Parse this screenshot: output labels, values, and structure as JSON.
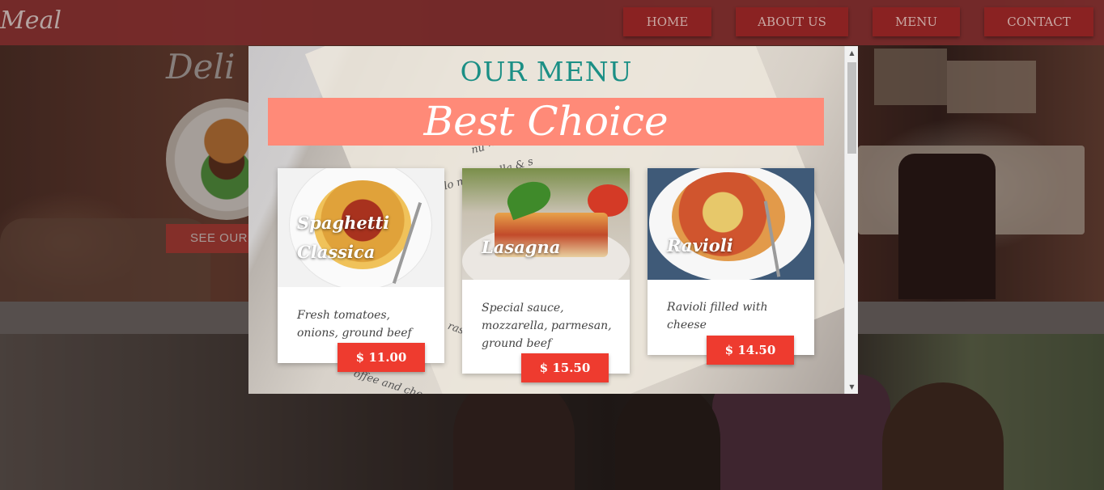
{
  "navbar": {
    "brand": "Meal",
    "links": [
      "HOME",
      "ABOUT US",
      "MENU",
      "CONTACT"
    ]
  },
  "hero": {
    "title_partial": "Deli",
    "see_our_label": "SEE OUR"
  },
  "modal": {
    "heading": "OUR MENU",
    "banner": "Best Choice",
    "paper_text": [
      "alo mozzarella & s",
      "nu ~",
      "ras",
      "offee and choc"
    ],
    "cards": [
      {
        "title": "Spaghetti Classica",
        "description": "Fresh tomatoes, onions, ground beef",
        "price": "$ 11.00"
      },
      {
        "title": "Lasagna",
        "description": "Special sauce, mozzarella, parmesan, ground beef",
        "price": "$ 15.50"
      },
      {
        "title": "Ravioli",
        "description": "Ravioli filled with cheese",
        "price": "$ 14.50"
      }
    ]
  },
  "scrollbar": {
    "up_icon": "▲",
    "down_icon": "▼"
  },
  "colors": {
    "navbar_bg": "#782a2a",
    "nav_button": "#8a2222",
    "heading_teal": "#1b8f85",
    "banner_salmon": "#ff8a78",
    "price_red": "#ee3b2f"
  }
}
